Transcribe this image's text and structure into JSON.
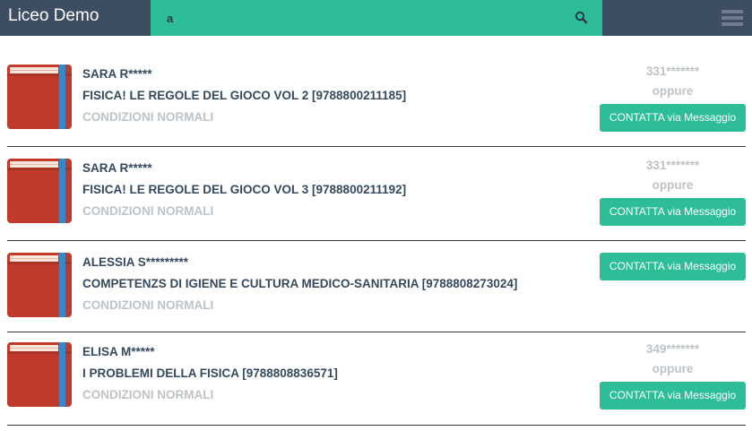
{
  "app": {
    "title": "Liceo Demo"
  },
  "search": {
    "value": "a",
    "icon": "search-icon"
  },
  "menu": {
    "icon": "hamburger-menu-icon"
  },
  "colors": {
    "topbar": "#3d4e63",
    "accent": "#2dbd98",
    "text": "#34495e",
    "muted": "#bdc3c7",
    "book_red": "#c0392b",
    "book_ribbon": "#3a87c8"
  },
  "listings": [
    {
      "seller": "SARA R*****",
      "title": "FISICA! LE REGOLE DEL GIOCO VOL 2 [9788800211185]",
      "condition": "CONDIZIONI NORMALI",
      "phone": "331*******",
      "oppure": "oppure",
      "button": "CONTATTA via Messaggio"
    },
    {
      "seller": "SARA R*****",
      "title": "FISICA! LE REGOLE DEL GIOCO VOL 3 [9788800211192]",
      "condition": "CONDIZIONI NORMALI",
      "phone": "331*******",
      "oppure": "oppure",
      "button": "CONTATTA via Messaggio"
    },
    {
      "seller": "ALESSIA S*********",
      "title": "COMPETENZS DI IGIENE E CULTURA MEDICO-SANITARIA [9788808273024]",
      "condition": "CONDIZIONI NORMALI",
      "phone": null,
      "oppure": null,
      "button": "CONTATTA via Messaggio"
    },
    {
      "seller": "ELISA M*****",
      "title": "I PROBLEMI DELLA FISICA [9788808836571]",
      "condition": "CONDIZIONI NORMALI",
      "phone": "349*******",
      "oppure": "oppure",
      "button": "CONTATTA via Messaggio"
    }
  ]
}
